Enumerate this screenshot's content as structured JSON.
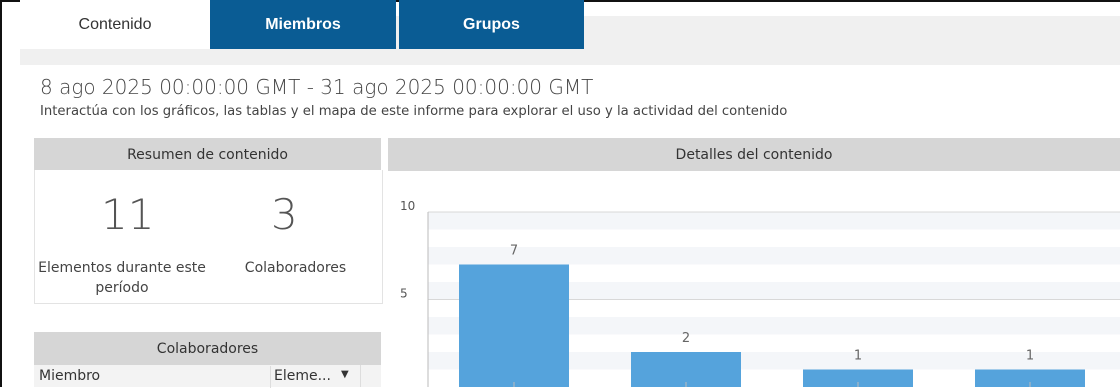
{
  "tabs": [
    {
      "label": "Contenido",
      "active": true
    },
    {
      "label": "Miembros",
      "active": false
    },
    {
      "label": "Grupos",
      "active": false
    }
  ],
  "report": {
    "date_range": "8 ago 2025 00:00:00 GMT - 31 ago 2025 00:00:00 GMT",
    "subtitle": "Interactúa con los gráficos, las tablas y el mapa de este informe para explorar el uso y la actividad del contenido"
  },
  "summary": {
    "title": "Resumen de contenido",
    "items_count": "11",
    "items_label": "Elementos durante este período",
    "contributors_count": "3",
    "contributors_label": "Colaboradores"
  },
  "contributors_table": {
    "title": "Colaboradores",
    "columns": [
      "Miembro",
      "Eleme..."
    ]
  },
  "details": {
    "title": "Detalles del contenido"
  },
  "colors": {
    "tab_active_bg": "#ffffff",
    "tab_inactive_bg": "#0a5c94",
    "header_bg": "#d6d6d6",
    "bar": "#55a3dc"
  },
  "chart_data": {
    "type": "bar",
    "categories": [
      "",
      "",
      "",
      ""
    ],
    "values": [
      7,
      2,
      1,
      1
    ],
    "yticks": [
      5,
      10
    ],
    "ylim": [
      0,
      10
    ],
    "grid": true
  }
}
